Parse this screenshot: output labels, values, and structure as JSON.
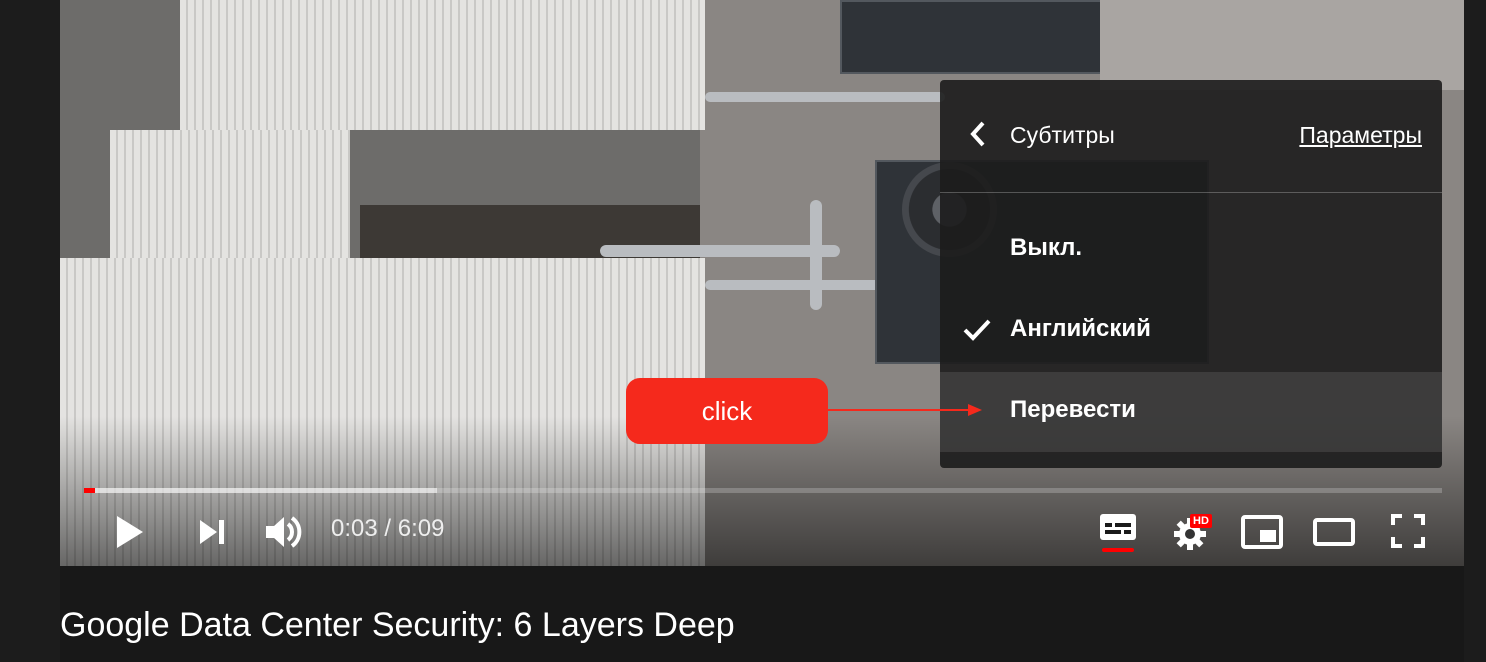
{
  "player": {
    "time_current": "0:03",
    "time_separator": " / ",
    "time_total": "6:09",
    "progress_played_pct": 0.8,
    "progress_buffered_pct": 26,
    "hd_badge": "HD",
    "accent_color": "#ff0000"
  },
  "settings_menu": {
    "title": "Субтитры",
    "options_link": "Параметры",
    "items": [
      {
        "label": "Выкл.",
        "checked": false
      },
      {
        "label": "Английский",
        "checked": true
      },
      {
        "label": "Перевести",
        "checked": false,
        "highlighted": true
      }
    ]
  },
  "annotation": {
    "label": "click",
    "color": "#f5291c"
  },
  "video": {
    "title": "Google Data Center Security: 6 Layers Deep"
  }
}
